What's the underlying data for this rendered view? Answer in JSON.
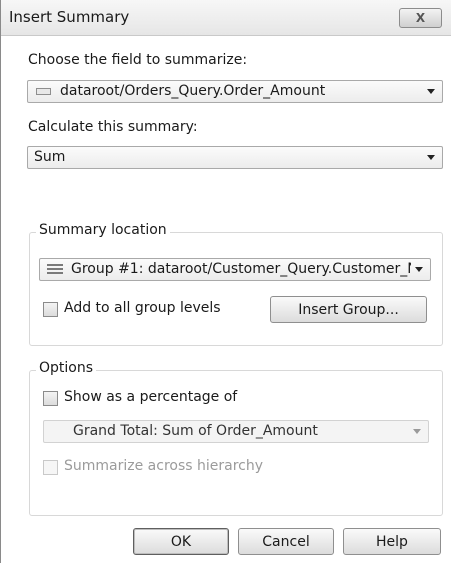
{
  "window": {
    "title": "Insert Summary",
    "close_glyph": "X"
  },
  "field": {
    "label": "Choose the field to summarize:",
    "value": "dataroot/Orders_Query.Order_Amount"
  },
  "summary": {
    "label": "Calculate this summary:",
    "value": "Sum"
  },
  "location": {
    "legend": "Summary location",
    "value": "Group #1: dataroot/Customer_Query.Customer_N",
    "add_all_label": "Add to all group levels",
    "add_all_checked": false,
    "insert_group_label": "Insert Group..."
  },
  "options": {
    "legend": "Options",
    "percent_label": "Show as a percentage of",
    "percent_checked": false,
    "percent_value": "Grand Total: Sum of Order_Amount",
    "hierarchy_label": "Summarize across hierarchy",
    "hierarchy_checked": false
  },
  "buttons": {
    "ok": "OK",
    "cancel": "Cancel",
    "help": "Help"
  }
}
